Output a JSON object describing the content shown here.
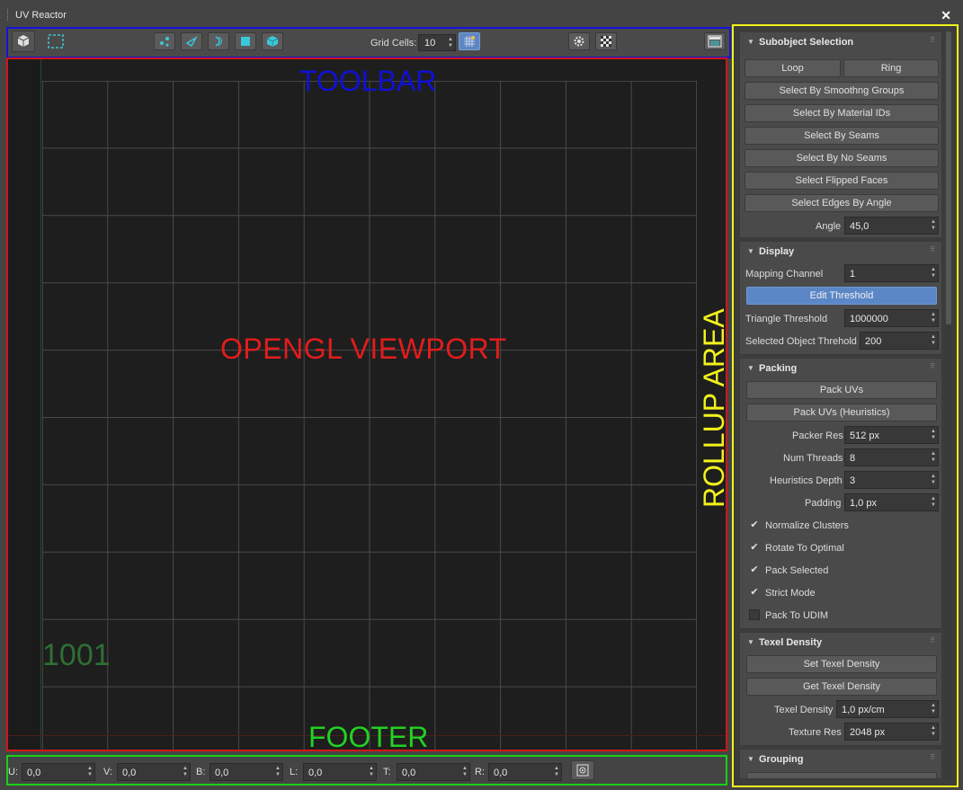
{
  "window": {
    "title": "UV Reactor",
    "close_glyph": "✕"
  },
  "toolbar": {
    "grid_cells_label": "Grid Cells:",
    "grid_cells_value": "10",
    "buttons": [
      "view-cube-icon",
      "selection-rect-icon",
      "vertex-mode-icon",
      "edge-mode-icon",
      "seam-mode-icon",
      "face-mode-icon",
      "element-mode-icon",
      "grid-settings-icon",
      "settings-gear-icon",
      "checker-icon",
      "panel-toggle-icon"
    ]
  },
  "overlay_labels": {
    "toolbar": "TOOLBAR",
    "viewport": "OPENGL VIEWPORT",
    "footer": "FOOTER",
    "rollup": "ROLLUP AREA"
  },
  "viewport": {
    "udim": "1001",
    "grid_cells": 10
  },
  "footer": {
    "fields": [
      {
        "label": "U:",
        "value": "0,0"
      },
      {
        "label": "V:",
        "value": "0,0"
      },
      {
        "label": "B:",
        "value": "0,0"
      },
      {
        "label": "L:",
        "value": "0,0"
      },
      {
        "label": "T:",
        "value": "0,0"
      },
      {
        "label": "R:",
        "value": "0,0"
      }
    ]
  },
  "rollups": {
    "subobject": {
      "title": "Subobject Selection",
      "loop": "Loop",
      "ring": "Ring",
      "smoothing": "Select By Smoothng Groups",
      "material": "Select By Material IDs",
      "seams": "Select By Seams",
      "noseams": "Select By No Seams",
      "flipped": "Select Flipped Faces",
      "edges_angle": "Select Edges By Angle",
      "angle_label": "Angle",
      "angle_value": "45,0"
    },
    "display": {
      "title": "Display",
      "mapping_label": "Mapping Channel",
      "mapping_value": "1",
      "edit_threshold": "Edit Threshold",
      "triangle_label": "Triangle Threshold",
      "triangle_value": "1000000",
      "selobj_label": "Selected Object Threhold",
      "selobj_value": "200"
    },
    "packing": {
      "title": "Packing",
      "pack": "Pack UVs",
      "pack_heur": "Pack UVs (Heuristics)",
      "packer_res_label": "Packer Res",
      "packer_res_value": "512 px",
      "threads_label": "Num Threads",
      "threads_value": "8",
      "heur_depth_label": "Heuristics Depth",
      "heur_depth_value": "3",
      "padding_label": "Padding",
      "padding_value": "1,0 px",
      "normalize": {
        "label": "Normalize Clusters",
        "checked": true
      },
      "rotate": {
        "label": "Rotate To Optimal",
        "checked": true
      },
      "selected": {
        "label": "Pack Selected",
        "checked": true
      },
      "strict": {
        "label": "Strict Mode",
        "checked": true
      },
      "udim": {
        "label": "Pack To UDIM",
        "checked": false
      }
    },
    "texel": {
      "title": "Texel Density",
      "set": "Set Texel Density",
      "get": "Get Texel Density",
      "density_label": "Texel Density",
      "density_value": "1,0 px/cm",
      "res_label": "Texture Res",
      "res_value": "2048 px"
    },
    "grouping": {
      "title": "Grouping"
    }
  },
  "colors": {
    "toolbar_outline": "#1414d8",
    "viewport_outline": "#d31515",
    "footer_outline": "#18d018",
    "rollup_outline": "#f2f21c",
    "accent_button": "#5b87c7"
  }
}
